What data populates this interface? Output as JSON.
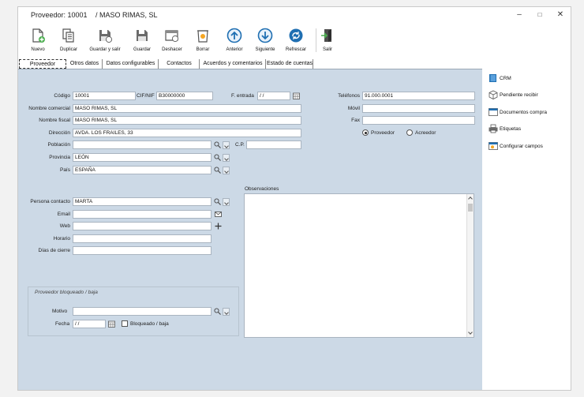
{
  "window": {
    "title_code": "Proveedor: 10001",
    "title_name": "/ MASO RIMAS, SL",
    "controls": {
      "minimize": "–",
      "maximize": "□",
      "close": "✕"
    }
  },
  "toolbar": {
    "nuevo": "Nuevo",
    "duplicar": "Duplicar",
    "guardar_salir": "Guardar y salir",
    "guardar": "Guardar",
    "deshacer": "Deshacer",
    "borrar": "Borrar",
    "anterior": "Anterior",
    "siguiente": "Siguiente",
    "refrescar": "Refrescar",
    "salir": "Salir"
  },
  "tabs": [
    {
      "label": "Proveedor"
    },
    {
      "label": "Otros datos"
    },
    {
      "label": "Datos configurables"
    },
    {
      "label": "Contactos"
    },
    {
      "label": "Acuerdos y comentarios"
    },
    {
      "label": "Estado de cuentas"
    }
  ],
  "form": {
    "codigo_label": "Código",
    "codigo": "10001",
    "cif_label": "CIF/NIF",
    "cif": "B30000000",
    "f_entrada_label": "F. entrada",
    "f_entrada": " / /",
    "nombre_comercial_label": "Nombre comercial",
    "nombre_comercial": "MASO RIMAS, SL",
    "nombre_fiscal_label": "Nombre fiscal",
    "nombre_fiscal": "MASO RIMAS, SL",
    "direccion_label": "Dirección",
    "direccion": "AVDA. LOS FRAILES, 33",
    "poblacion_label": "Población",
    "poblacion": "",
    "cp_label": "C.P.",
    "cp": "",
    "provincia_label": "Provincia",
    "provincia": "LEÓN",
    "pais_label": "País",
    "pais": "ESPAÑA",
    "telefonos_label": "Teléfonos",
    "telefonos": "91.000.0001",
    "movil_label": "Móvil",
    "movil": "",
    "fax_label": "Fax",
    "fax": "",
    "tipo_proveedor": "Proveedor",
    "tipo_acreedor": "Acreedor",
    "persona_contacto_label": "Persona contacto",
    "persona_contacto": "MARTA",
    "email_label": "Email",
    "email": "",
    "web_label": "Web",
    "web": "",
    "horario_label": "Horario",
    "horario": "",
    "dias_cierre_label": "Días de cierre",
    "dias_cierre": "",
    "observaciones_label": "Observaciones",
    "bloqueado_group": "Proveedor bloqueado / baja",
    "motivo_label": "Motivo",
    "motivo": "",
    "fecha_label": "Fecha",
    "fecha": " / /",
    "bloqueado_check": "Bloqueado / baja"
  },
  "side": {
    "crm": "CRM",
    "pendiente": "Pendiente recibir",
    "documentos": "Documentos compra",
    "etiquetas": "Etiquetas",
    "configurar": "Configurar campos"
  },
  "colors": {
    "panel": "#ccd9e6",
    "accent_blue": "#1f6fb2",
    "toolbar_gray": "#4d4d4d"
  }
}
